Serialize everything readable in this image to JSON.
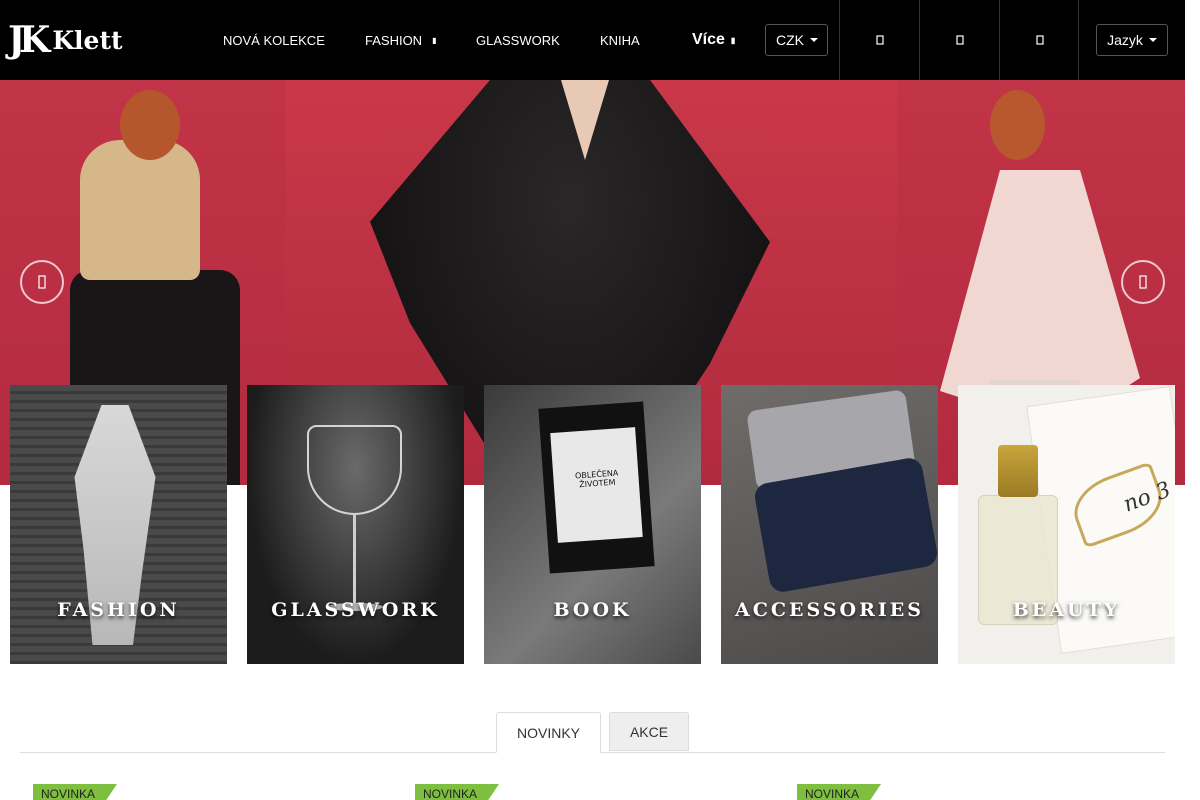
{
  "header": {
    "logo_mark": "JK",
    "logo_word": "Klett",
    "nav": [
      {
        "label": "NOVÁ KOLEKCE"
      },
      {
        "label": "FASHION"
      },
      {
        "label": "GLASSWORK"
      },
      {
        "label": "KNIHA"
      }
    ],
    "more_label": "Více",
    "currency": "CZK",
    "language": "Jazyk",
    "icons": [
      "search-icon",
      "user-icon",
      "cart-icon"
    ]
  },
  "hero": {
    "prev_icon": "chevron-left-icon",
    "next_icon": "chevron-right-icon"
  },
  "categories": [
    {
      "label": "FASHION"
    },
    {
      "label": "GLASSWORK"
    },
    {
      "label": "BOOK",
      "book_title": "OBLEČENA ŽIVOTEM"
    },
    {
      "label": "ACCESSORIES"
    },
    {
      "label": "BEAUTY",
      "mark": "no 3"
    }
  ],
  "tabs": [
    {
      "label": "NOVINKY",
      "active": true
    },
    {
      "label": "AKCE",
      "active": false
    }
  ],
  "products": [
    {
      "badge": "NOVINKA"
    },
    {
      "badge": "NOVINKA"
    },
    {
      "badge": "NOVINKA"
    }
  ],
  "colors": {
    "header_bg": "#000000",
    "hero_bg": "#b92a41",
    "badge_bg": "#7fbf3f"
  }
}
